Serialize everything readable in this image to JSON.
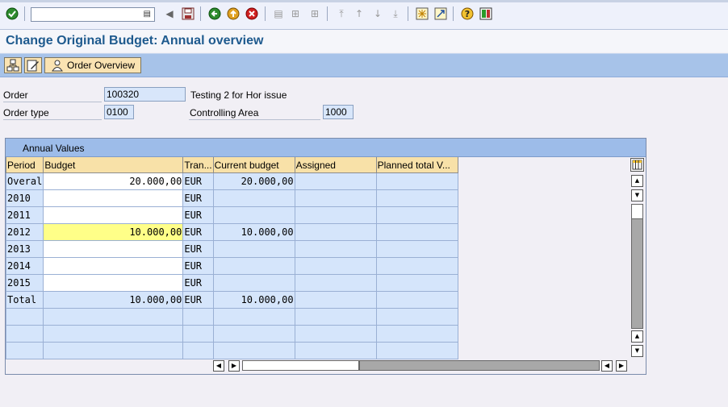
{
  "toolbar": {
    "command_field_value": "",
    "icons": [
      "enter-icon",
      "dropdown-icon",
      "back-nav-icon",
      "save-icon",
      "back-icon",
      "exit-icon",
      "cancel-icon",
      "print-icon",
      "find-icon",
      "find-next-icon",
      "first-page-icon",
      "previous-page-icon",
      "next-page-icon",
      "last-page-icon",
      "create-session-icon",
      "shortcut-icon",
      "help-icon",
      "layout-icon"
    ]
  },
  "title": "Change Original Budget: Annual overview",
  "appbar": {
    "order_overview_label": "Order Overview"
  },
  "header": {
    "order_label": "Order",
    "order_value": "100320",
    "order_desc": "Testing 2 for Hor issue",
    "order_type_label": "Order type",
    "order_type_value": "0100",
    "controlling_area_label": "Controlling Area",
    "controlling_area_value": "1000"
  },
  "annual_values": {
    "title": "Annual Values",
    "columns": [
      "Period",
      "Budget",
      "Tran...",
      "Current budget",
      "Assigned",
      "Planned total V..."
    ],
    "rows": [
      {
        "period": "Overal",
        "budget": "20.000,00",
        "tran": "EUR",
        "current": "20.000,00",
        "assigned": "",
        "planned": ""
      },
      {
        "period": "2010",
        "budget": "",
        "tran": "EUR",
        "current": "",
        "assigned": "",
        "planned": ""
      },
      {
        "period": "2011",
        "budget": "",
        "tran": "EUR",
        "current": "",
        "assigned": "",
        "planned": ""
      },
      {
        "period": "2012",
        "budget": "10.000,00",
        "tran": "EUR",
        "current": "10.000,00",
        "assigned": "",
        "planned": ""
      },
      {
        "period": "2013",
        "budget": "",
        "tran": "EUR",
        "current": "",
        "assigned": "",
        "planned": ""
      },
      {
        "period": "2014",
        "budget": "",
        "tran": "EUR",
        "current": "",
        "assigned": "",
        "planned": ""
      },
      {
        "period": "2015",
        "budget": "",
        "tran": "EUR",
        "current": "",
        "assigned": "",
        "planned": ""
      },
      {
        "period": "Total",
        "budget": "10.000,00",
        "tran": "EUR",
        "current": "10.000,00",
        "assigned": "",
        "planned": ""
      },
      {
        "period": "",
        "budget": "",
        "tran": "",
        "current": "",
        "assigned": "",
        "planned": ""
      },
      {
        "period": "",
        "budget": "",
        "tran": "",
        "current": "",
        "assigned": "",
        "planned": ""
      },
      {
        "period": "",
        "budget": "",
        "tran": "",
        "current": "",
        "assigned": "",
        "planned": ""
      }
    ]
  }
}
